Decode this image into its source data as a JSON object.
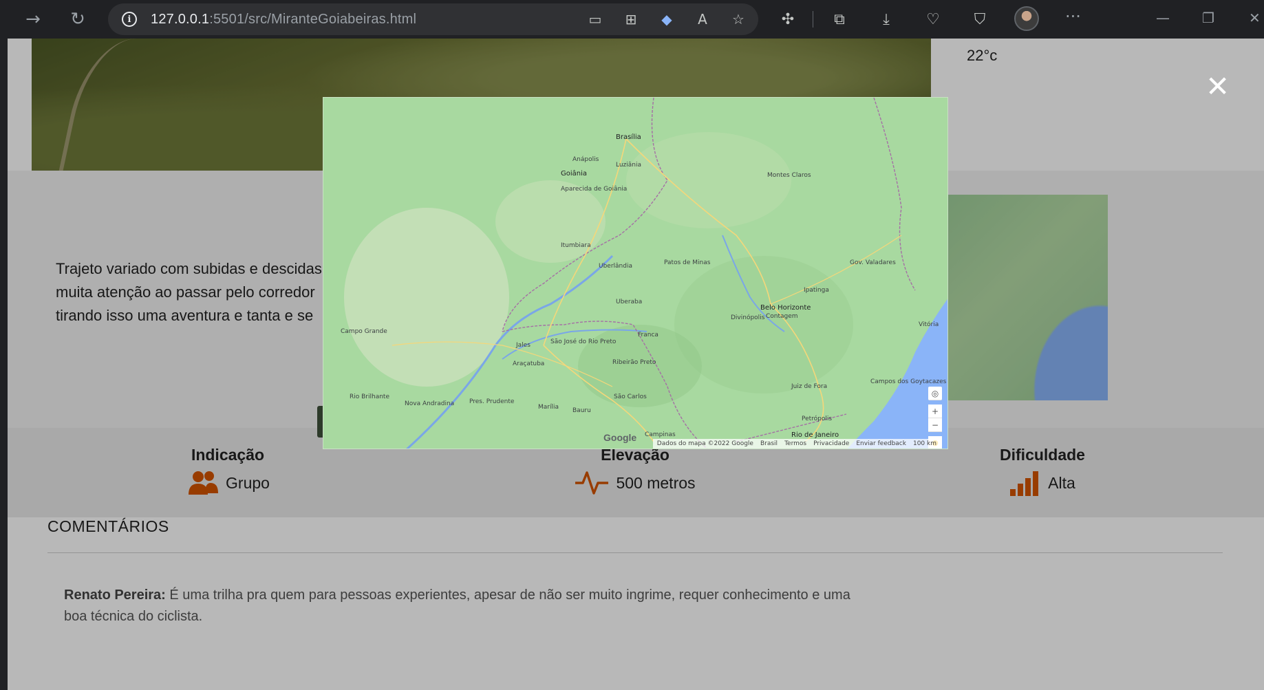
{
  "browser": {
    "url_host": "127.0.0.1",
    "url_rest": ":5501/src/MiranteGoiabeiras.html"
  },
  "page": {
    "temperature": "22°c",
    "description_lines": [
      "Trajeto variado com subidas e descidas",
      "muita atenção ao passar pelo corredor",
      "tirando isso uma aventura e tanta e se"
    ],
    "stats": {
      "indicacao": {
        "title": "Indicação",
        "value": "Grupo"
      },
      "elevacao": {
        "title": "Elevação",
        "value": "500 metros"
      },
      "dificuldade": {
        "title": "Dificuldade",
        "value": "Alta"
      }
    },
    "comments_title": "COMENTÁRIOS",
    "comment": {
      "author": "Renato Pereira:",
      "text": " É uma trilha pra quem para pessoas experientes, apesar de não ser muito ingrime, requer conhecimento e uma boa técnica do ciclista."
    }
  },
  "modal": {
    "close_symbol": "✕",
    "map": {
      "cities": [
        "Brasília",
        "Anápolis",
        "Goiânia",
        "Aparecida de Goiânia",
        "Luziânia",
        "Montes Claros",
        "Itumbiara",
        "Uberlândia",
        "Uberaba",
        "Patos de Minas",
        "Belo Horizonte",
        "Contagem",
        "Divinópolis",
        "Ipatinga",
        "Gov. Valadares",
        "Franca",
        "Ribeirão Preto",
        "São José do Rio Preto",
        "Araçatuba",
        "Pres. Prudente",
        "Bauru",
        "São Carlos",
        "Campinas",
        "Campo Grande",
        "Juiz de Fora",
        "Petrópolis",
        "Rio de Janeiro",
        "Vitória",
        "Campos dos Goytacazes",
        "Nova Andradina",
        "Rio Brilhante",
        "Marília",
        "Jales"
      ],
      "google_logo": "Google",
      "attribution": [
        "Dados do mapa ©2022 Google",
        "Brasil",
        "Termos",
        "Privacidade",
        "Enviar feedback",
        "100 km"
      ],
      "controls": {
        "zoom_in": "+",
        "zoom_out": "−"
      }
    }
  }
}
